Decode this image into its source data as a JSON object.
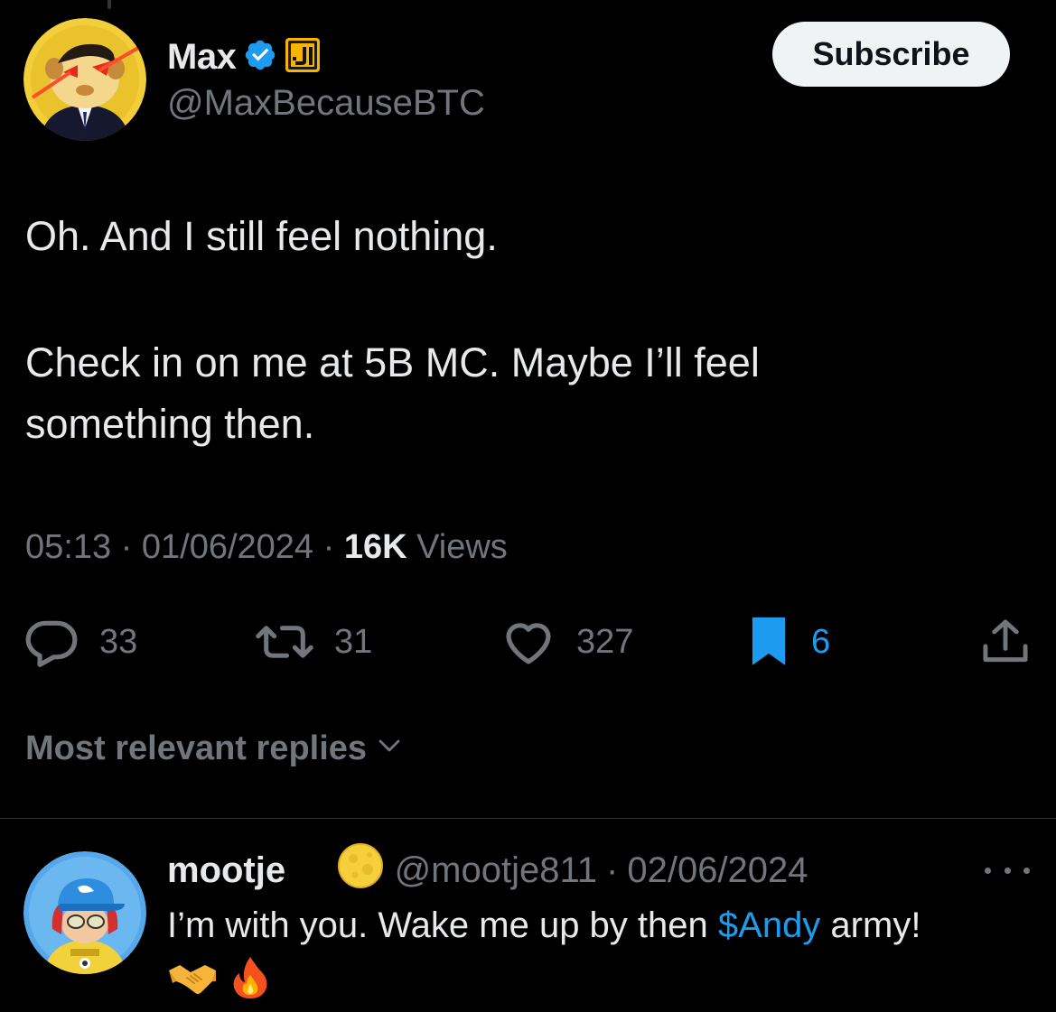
{
  "main_tweet": {
    "author": {
      "name": "Max",
      "handle": "@MaxBecauseBTC",
      "affiliate_badge_text": "JI"
    },
    "subscribe_label": "Subscribe",
    "text_line1": "Oh. And I still feel nothing.",
    "text_line2a": "Check in on me at 5B MC. Maybe I’ll feel",
    "text_line2b": "something then.",
    "time": "05:13",
    "date": "01/06/2024",
    "views_count": "16K",
    "views_label": "Views",
    "separator": " · ",
    "stats": {
      "replies": "33",
      "reposts": "31",
      "likes": "327",
      "bookmarks": "6"
    }
  },
  "replies_sort": {
    "label": "Most relevant replies"
  },
  "reply": {
    "name": "mootje",
    "handle": "@mootje811",
    "separator": "·",
    "date": "02/06/2024",
    "text_before": "I’m with you. Wake me up by then ",
    "cashtag": "$Andy",
    "text_after": " army!",
    "emojis": [
      "handshake",
      "fire"
    ]
  },
  "colors": {
    "background": "#000000",
    "text_primary": "#e7e9ea",
    "text_secondary": "#71767b",
    "accent_blue": "#1d9bf0",
    "verified_badge": "#1d9bf0",
    "affiliate_gold": "#f7b500",
    "subscribe_bg": "#eff3f4"
  },
  "icons": {
    "verified": "verified-badge-icon",
    "reply": "speech-bubble-icon",
    "repost": "repost-arrows-icon",
    "like": "heart-outline-icon",
    "bookmark": "bookmark-filled-icon",
    "share": "share-upload-icon",
    "sort": "chevron-down-icon",
    "more": "more-dots-icon"
  }
}
